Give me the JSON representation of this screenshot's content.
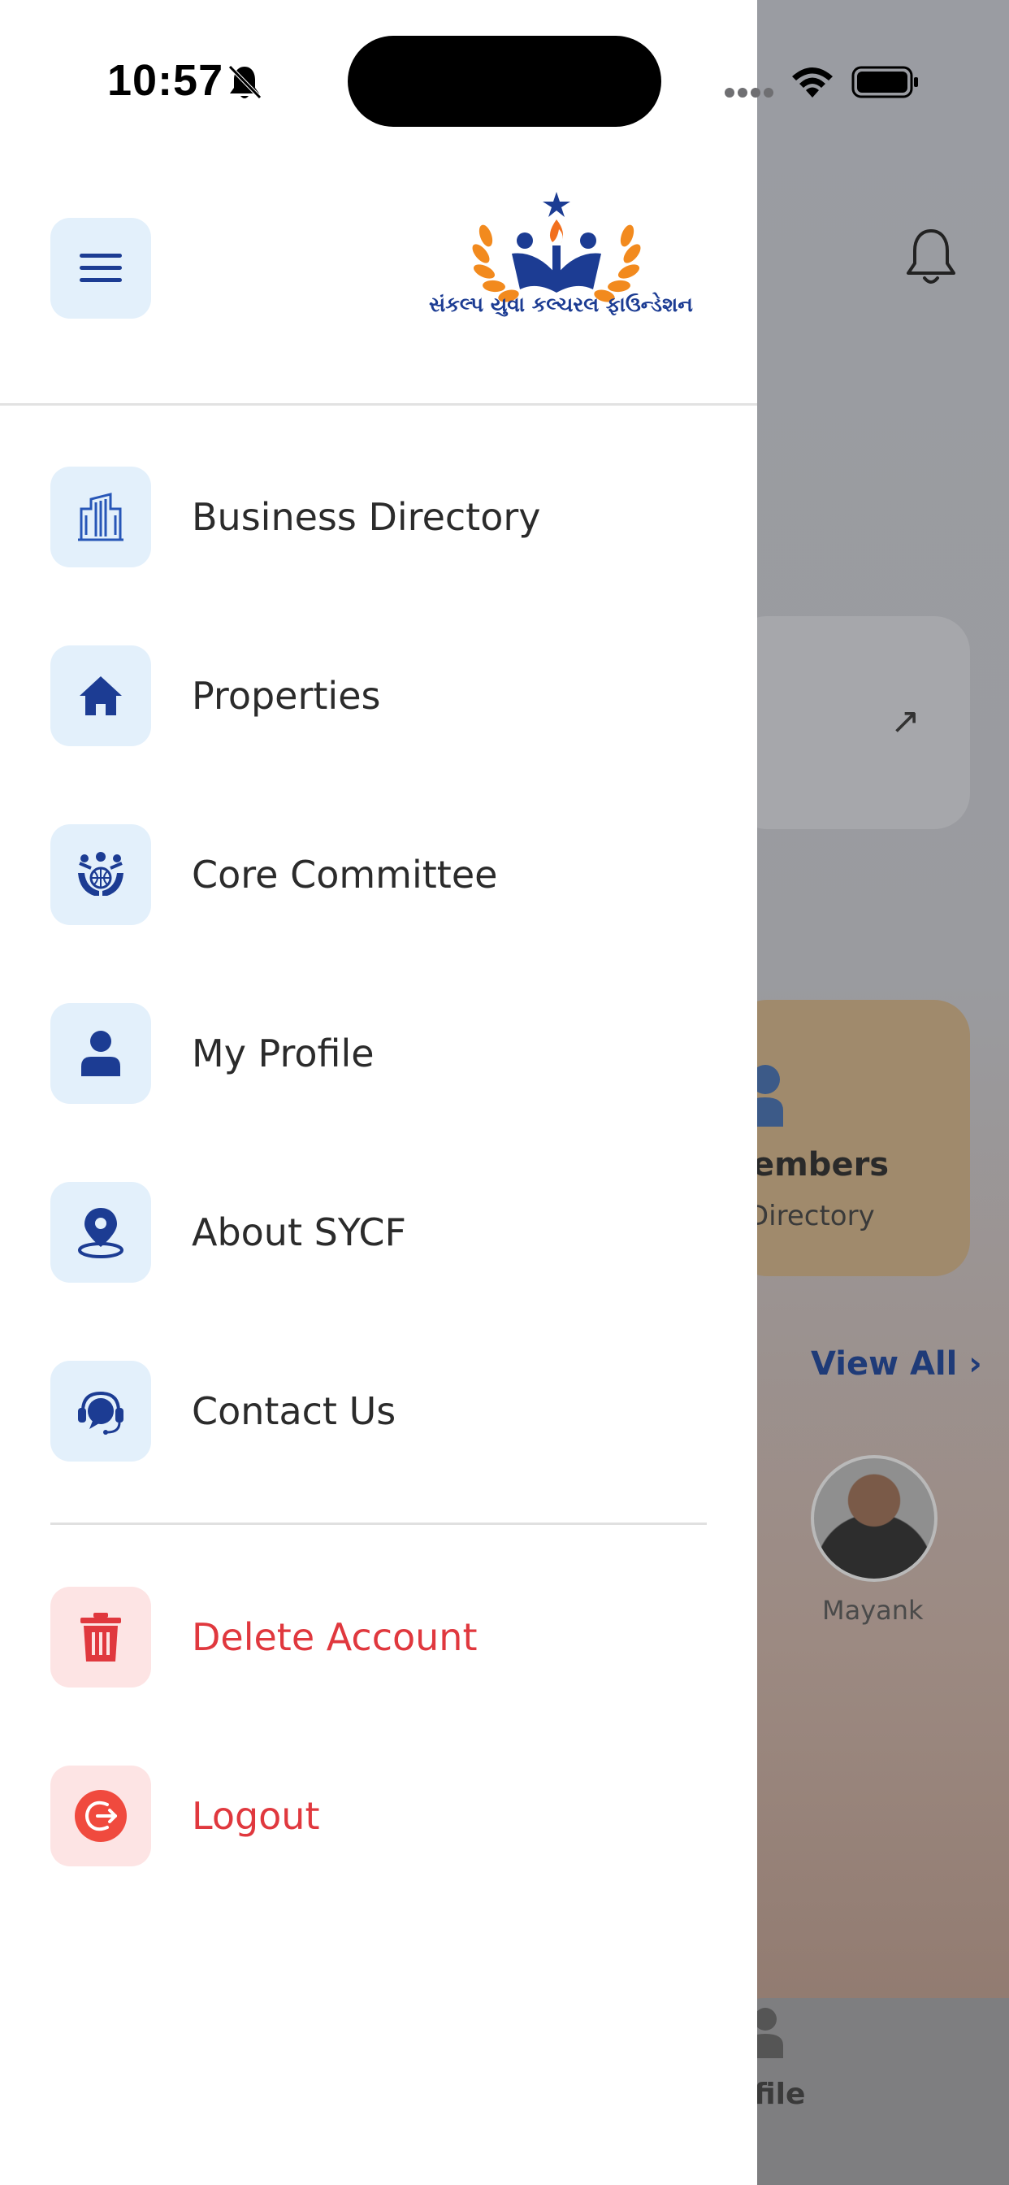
{
  "status_bar": {
    "time": "10:57",
    "icons": [
      "bell-slash-icon",
      "signal-icon",
      "wifi-icon",
      "battery-icon"
    ]
  },
  "drawer": {
    "logo_caption": "સંકલ્પ યુવા કલ્ચરલ ફાઉન્ડેશન",
    "menu_items": [
      {
        "label": "Business Directory",
        "icon": "building-icon"
      },
      {
        "label": "Properties",
        "icon": "home-icon"
      },
      {
        "label": "Core Committee",
        "icon": "committee-icon"
      },
      {
        "label": "My Profile",
        "icon": "user-icon"
      },
      {
        "label": "About SYCF",
        "icon": "location-pin-icon"
      },
      {
        "label": "Contact Us",
        "icon": "headset-icon"
      }
    ],
    "danger_items": [
      {
        "label": "Delete Account",
        "icon": "trash-icon"
      },
      {
        "label": "Logout",
        "icon": "logout-icon"
      }
    ]
  },
  "background_app": {
    "card_title_partial": "embers",
    "card_sub_partial": "Directory",
    "view_all": "View All ›",
    "member_name": "Mayank",
    "tab_label_partial": "file"
  },
  "colors": {
    "accent": "#1c3c93",
    "tile_bg": "#e3f0fb",
    "danger": "#e0383e",
    "danger_tile_bg": "#fde4e4"
  }
}
